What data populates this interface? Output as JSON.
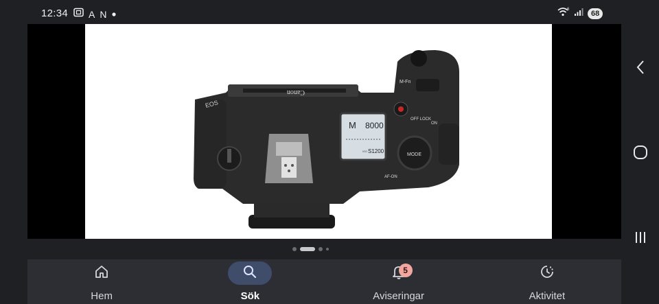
{
  "status_bar": {
    "time": "12:34",
    "icons": [
      "screenshot-icon",
      "a-icon",
      "n-icon",
      "dot-icon"
    ],
    "glyph_a": "A",
    "glyph_n": "N",
    "wifi_label": "6",
    "battery": "68"
  },
  "viewer": {
    "image": "canon-camera-top-view",
    "image_text": {
      "brand": "Canon",
      "model": "EOS",
      "lcd_mode": "M",
      "lcd_value": "8000",
      "lcd_iso": "S1200",
      "lcd_iso_prefix": "ISO",
      "label_mfn": "M-Fn",
      "label_off_lock": "OFF LOCK",
      "label_on": "ON",
      "label_mode": "MODE",
      "label_af_on": "AF-ON"
    },
    "pager": {
      "count": 4,
      "active_index": 1
    }
  },
  "bottom_nav": {
    "items": [
      {
        "label": "Hem",
        "icon": "home-icon",
        "active": false
      },
      {
        "label": "Sök",
        "icon": "search-icon",
        "active": true
      },
      {
        "label": "Aviseringar",
        "icon": "bell-icon",
        "active": false,
        "badge": "5"
      },
      {
        "label": "Aktivitet",
        "icon": "activity-icon",
        "active": false
      }
    ]
  },
  "system_nav": [
    "back-icon",
    "home-circle-icon",
    "recents-icon"
  ],
  "colors": {
    "background": "#1f2023",
    "nav_bar": "#2c2e33",
    "active_pill": "#3f4d6b",
    "badge": "#f2a6a0"
  }
}
